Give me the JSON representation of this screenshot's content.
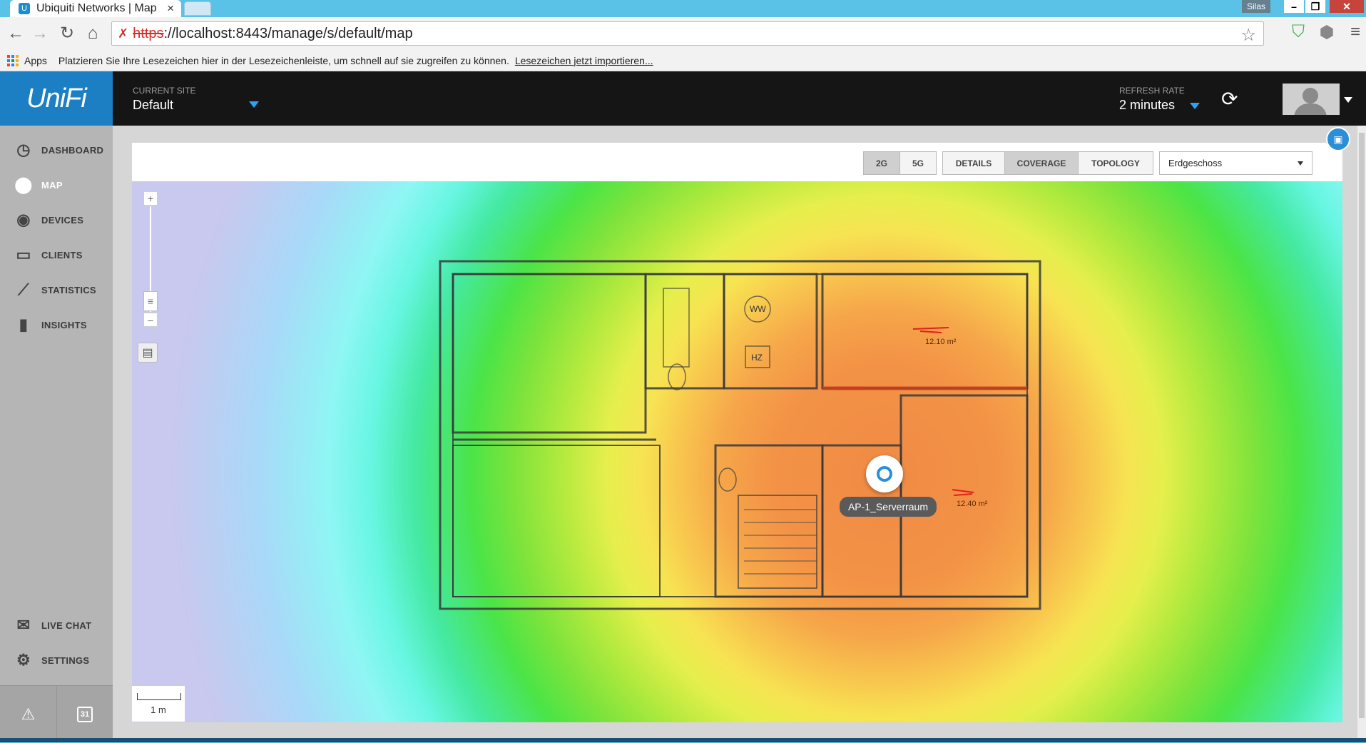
{
  "browser": {
    "tab_title": "Ubiquiti Networks | Map",
    "tab_close": "×",
    "user_badge": "Silas",
    "url_scheme": "https",
    "url_rest": "://localhost:8443/manage/s/default/map",
    "bookmarks_apps": "Apps",
    "bookmarks_hint": "Platzieren Sie Ihre Lesezeichen hier in der Lesezeichenleiste, um schnell auf sie zugreifen zu können.",
    "bookmarks_import": "Lesezeichen jetzt importieren..."
  },
  "header": {
    "logo": "UniFi",
    "site_label": "CURRENT SITE",
    "site_value": "Default",
    "refresh_label": "REFRESH RATE",
    "refresh_value": "2 minutes"
  },
  "sidebar": {
    "items": [
      {
        "label": "DASHBOARD",
        "icon": "dashboard-icon"
      },
      {
        "label": "MAP",
        "icon": "map-pin-icon",
        "active": true
      },
      {
        "label": "DEVICES",
        "icon": "devices-icon"
      },
      {
        "label": "CLIENTS",
        "icon": "laptop-icon"
      },
      {
        "label": "STATISTICS",
        "icon": "line-chart-icon"
      },
      {
        "label": "INSIGHTS",
        "icon": "bar-chart-icon"
      }
    ],
    "bottom_items": [
      {
        "label": "LIVE CHAT",
        "icon": "chat-icon"
      },
      {
        "label": "SETTINGS",
        "icon": "gear-icon"
      }
    ],
    "footer": {
      "calendar_day": "31"
    }
  },
  "toolbar": {
    "band_2g": "2G",
    "band_5g": "5G",
    "details": "DETAILS",
    "coverage": "COVERAGE",
    "topology": "TOPOLOGY",
    "floor": "Erdgeschoss",
    "active_view": "COVERAGE"
  },
  "map": {
    "ap_name": "AP-1_Serverraum",
    "room_labels": [
      "WW",
      "HZ",
      "12.10 m²",
      "12.40 m²"
    ],
    "scale_label": "1 m",
    "zoom_in": "+",
    "zoom_out": "–"
  },
  "colors": {
    "accent": "#2b8ed9",
    "logo_bg": "#1c7fc3",
    "header_bg": "#151515",
    "sidebar_bg": "#b5b5b5",
    "heat_strong": "#f08a45",
    "heat_weak": "#8ff6f4"
  }
}
